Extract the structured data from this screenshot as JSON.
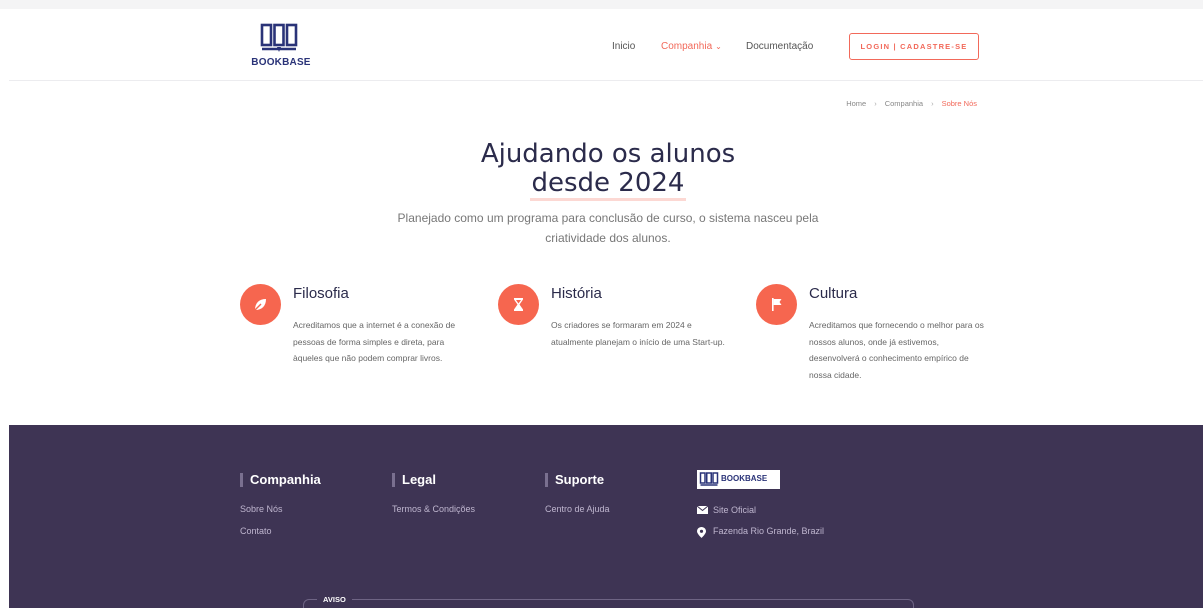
{
  "brand": {
    "name": "BOOKBASE",
    "color": "#2a3378"
  },
  "colors": {
    "accent": "#f2695a",
    "footer_bg": "#3e3454"
  },
  "nav": {
    "items": [
      {
        "label": "Inicio"
      },
      {
        "label": "Companhia"
      },
      {
        "label": "Documentação"
      }
    ],
    "login_label": "LOGIN | CADASTRE-SE"
  },
  "breadcrumb": [
    "Home",
    "Companhia",
    "Sobre Nós"
  ],
  "hero": {
    "title_line1": "Ajudando os alunos",
    "title_line2": "desde 2024",
    "subtitle": "Planejado como um programa para conclusão de curso, o sistema nasceu pela criatividade dos alunos."
  },
  "features": [
    {
      "icon": "leaf-icon",
      "title": "Filosofia",
      "description": "Acreditamos que a internet é a conexão de pessoas de forma simples e direta, para àqueles que não podem comprar livros."
    },
    {
      "icon": "hourglass-icon",
      "title": "História",
      "description": "Os criadores se formaram em 2024 e atualmente planejam o início de uma Start-up."
    },
    {
      "icon": "flag-icon",
      "title": "Cultura",
      "description": "Acreditamos que fornecendo o melhor para os nossos alunos, onde já estivemos, desenvolverá o conhecimento empírico de nossa cidade."
    }
  ],
  "footer": {
    "columns": [
      {
        "title": "Companhia",
        "links": [
          "Sobre Nós",
          "Contato"
        ]
      },
      {
        "title": "Legal",
        "links": [
          "Termos & Condições"
        ]
      },
      {
        "title": "Suporte",
        "links": [
          "Centro de Ajuda"
        ]
      }
    ],
    "brand_name": "BOOKBASE",
    "site_label": "Site Oficial",
    "address": "Fazenda Rio Grande, Brazil",
    "notice_label": "AVISO"
  }
}
